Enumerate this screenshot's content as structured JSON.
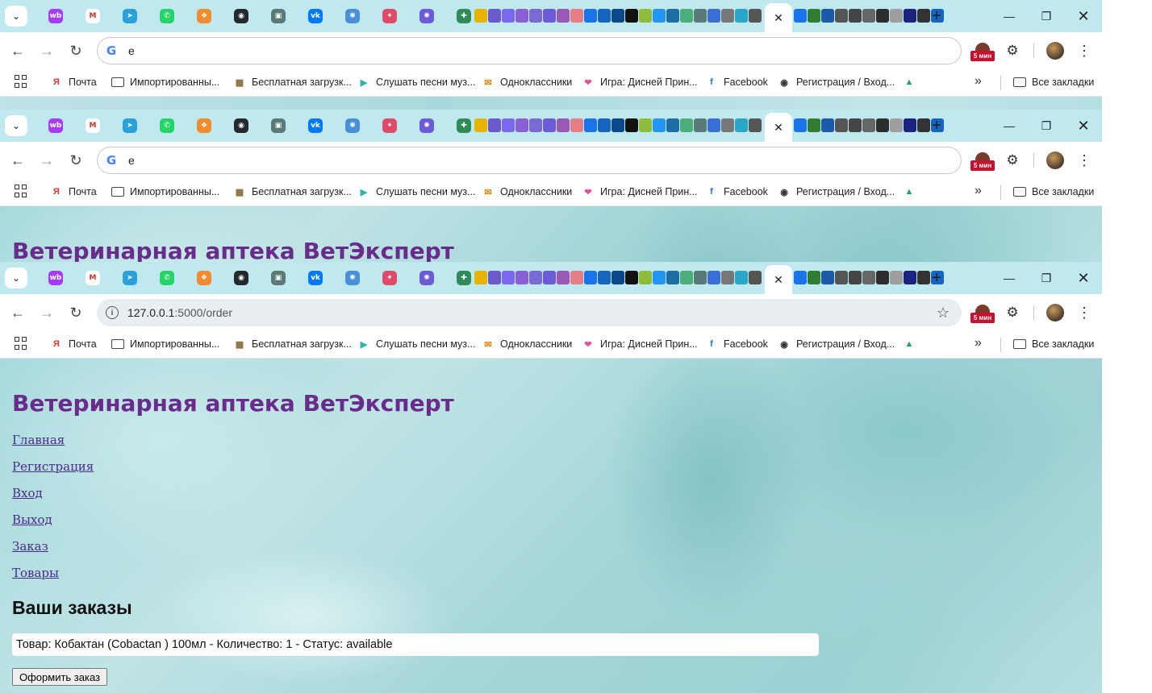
{
  "browser": {
    "tab_dropdown_icon": "chevron-down-icon",
    "pinned_tabs": [
      {
        "icon": "wildberries-icon",
        "color": "#a73afd",
        "glyph": "wb"
      },
      {
        "icon": "gmail-icon",
        "color": "#ffffff",
        "glyph": "M"
      },
      {
        "icon": "telegram-icon",
        "color": "#2aa1da",
        "glyph": "➤"
      },
      {
        "icon": "whatsapp-icon",
        "color": "#25d366",
        "glyph": "✆"
      },
      {
        "icon": "puzzle-orange-icon",
        "color": "#f28b30",
        "glyph": "❖"
      },
      {
        "icon": "github-icon",
        "color": "#24292e",
        "glyph": "◉"
      },
      {
        "icon": "app-icon",
        "color": "#5a7a78",
        "glyph": "▣"
      },
      {
        "icon": "vk-icon",
        "color": "#0077ff",
        "glyph": "vk"
      },
      {
        "icon": "sparkle-icon",
        "color": "#4a90d9",
        "glyph": "✺"
      },
      {
        "icon": "star-multi-icon",
        "color": "#e04a6a",
        "glyph": "✦"
      },
      {
        "icon": "sparkle-purple-icon",
        "color": "#6b5bd6",
        "glyph": "✺"
      },
      {
        "icon": "extension-icon",
        "color": "#2e8b57",
        "glyph": "✚"
      }
    ],
    "new_tab_label": "+",
    "window_controls": {
      "minimize": "—",
      "maximize": "❐",
      "close": "✕"
    },
    "close_tab_label": "✕"
  },
  "screenshots": [
    {
      "address_bar": {
        "text": "e",
        "has_google_icon": true
      },
      "page_title_visible": false
    },
    {
      "address_bar": {
        "text": "e",
        "has_google_icon": true
      },
      "page_title_visible": true
    },
    {
      "address_bar": {
        "host": "127.0.0.1",
        "rest": ":5000/order",
        "has_google_icon": false
      },
      "page_title_visible": true
    }
  ],
  "toolbar": {
    "extension_badge": "5 мин",
    "bookmark_star_icon": "star-icon"
  },
  "bookmarks": {
    "items": [
      {
        "label": "Почта",
        "icon": "yandex-icon",
        "icon_color": "#e8322c",
        "glyph": "Я"
      },
      {
        "label": "Импортированны...",
        "icon": "folder-icon",
        "icon_color": "#444444",
        "glyph": ""
      },
      {
        "label": "Бесплатная загрузк...",
        "icon": "download-icon",
        "icon_color": "#8a6a3a",
        "glyph": "▦"
      },
      {
        "label": "Слушать песни муз...",
        "icon": "play-icon",
        "icon_color": "#2ab6a8",
        "glyph": "▶"
      },
      {
        "label": "Одноклассники",
        "icon": "ok-icon",
        "icon_color": "#ee8208",
        "glyph": "✉"
      },
      {
        "label": "Игра: Дисней Прин...",
        "icon": "heart-icon",
        "icon_color": "#e0529c",
        "glyph": "❤"
      },
      {
        "label": "Facebook",
        "icon": "facebook-icon",
        "icon_color": "#1877f2",
        "glyph": "f"
      },
      {
        "label": "Регистрация / Вход...",
        "icon": "globe-icon",
        "icon_color": "#333333",
        "glyph": "◉"
      },
      {
        "label": "",
        "icon": "google-drive-icon",
        "icon_color": "#1fa463",
        "glyph": "▲"
      }
    ],
    "more_label": "»",
    "all_bookmarks_label": "Все закладки"
  },
  "page": {
    "site_title": "Ветеринарная аптека ВетЭксперт",
    "nav": [
      {
        "label": "Главная"
      },
      {
        "label": "Регистрация"
      },
      {
        "label": "Вход"
      },
      {
        "label": "Выход"
      },
      {
        "label": "Заказ"
      },
      {
        "label": "Товары"
      }
    ],
    "orders_heading": "Ваши заказы",
    "order_items": [
      "Товар: Кобактан (Cobactan ) 100мл - Количество: 1 - Статус: available"
    ],
    "submit_button": "Оформить заказ"
  }
}
